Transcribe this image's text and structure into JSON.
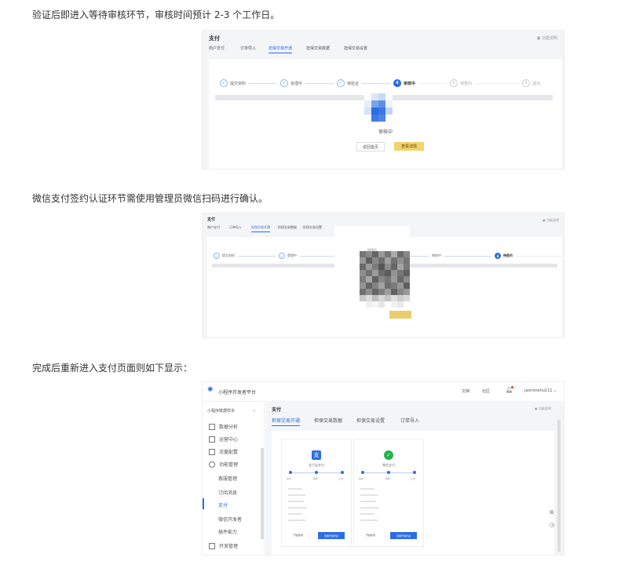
{
  "paragraphs": {
    "p1": "验证后即进入等待审核环节，审核时间预计 2-3 个工作日。",
    "p2": "微信支付签约认证环节需使用管理员微信扫码进行确认。",
    "p3": "完成后重新进入支付页面则如下显示："
  },
  "shot1": {
    "title": "支付",
    "help": "功能说明",
    "tabs": [
      "商户支付",
      "订单导入",
      "担保交易开通",
      "担保交易数据",
      "担保交易设置"
    ],
    "active_tab": 2,
    "steps": [
      "提交资料",
      "受理中",
      "待验证",
      "审核中",
      "待签约",
      "成功"
    ],
    "step_markers": [
      "✓",
      "✓",
      "✓",
      "4",
      "5",
      "6"
    ],
    "current_step": 3,
    "status": "审核中",
    "btn_back": "返回首页",
    "btn_detail": "查看详情"
  },
  "shot2": {
    "title": "支付",
    "help": "功能说明",
    "tabs": [
      "商户支付",
      "订单导入",
      "担保交易开通",
      "担保交易数据",
      "担保交易设置"
    ],
    "active_tab": 2,
    "steps": [
      "提交资料",
      "受理中",
      "审核中",
      "待签约",
      "成功"
    ],
    "step_markers": [
      "✓",
      "✓",
      "3",
      "4",
      "5"
    ],
    "current_step": 3,
    "qr_caption": "待签约"
  },
  "shot3": {
    "logo": "小程序开发者平台",
    "nav": [
      "文档",
      "社区"
    ],
    "user": "jasminehu111",
    "app_select": "小程序数据样本",
    "sidebar": [
      "数据分析",
      "运营中心",
      "流量配置",
      "功能管理",
      "客服管理",
      "订阅消息",
      "支付",
      "微信开发者",
      "插件能力",
      "开发管理"
    ],
    "active_side": 6,
    "title": "支付",
    "help": "功能说明",
    "tabs": [
      "担保交易开通",
      "担保交易数据",
      "担保交易设置",
      "订单导入"
    ],
    "active_tab": 0,
    "cards": [
      {
        "name": "支付宝支付",
        "steps": [
          "提交",
          "审核",
          "上线"
        ],
        "btn_left": "开始使用",
        "btn_right": "查看开通状态"
      },
      {
        "name": "微信支付",
        "steps": [
          "提交",
          "审核",
          "上线"
        ],
        "btn_left": "开始使用",
        "btn_right": "查看开通状态"
      }
    ],
    "colors": {
      "alipay": "#2b6de6",
      "wechat": "#22b24c"
    }
  }
}
